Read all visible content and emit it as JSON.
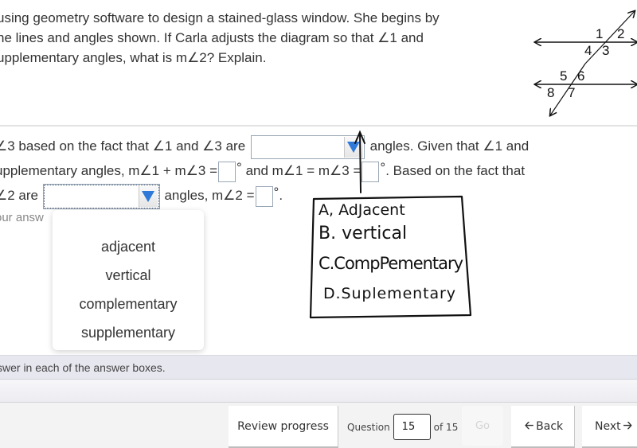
{
  "question": {
    "lines": [
      "using geometry software to design a stained-glass window. She begins by",
      "he lines and angles shown. If Carla adjusts the diagram so that ∠1 and",
      "upplementary angles, what is m∠2? Explain."
    ]
  },
  "diagram": {
    "labels": [
      "1",
      "2",
      "3",
      "4",
      "5",
      "6",
      "7",
      "8"
    ]
  },
  "answer": {
    "line1_a": "∠3 based on the fact that ∠1 and ∠3 are",
    "line1_b": "angles. Given that ∠1 and",
    "line2_a": "upplementary angles, m∠1 + m∠3 =",
    "line2_b": "and m∠1 = m∠3 =",
    "line2_c": ". Based on the fact that",
    "line3_a": "∠2 are",
    "line3_b": "angles, m∠2 =",
    "line3_c": ".",
    "degree": "°",
    "dropdown1_value": "",
    "dropdown2_value": "",
    "box1_value": "",
    "box2_value": "",
    "box3_value": ""
  },
  "hint": "our answ",
  "dropdown_menu": {
    "options": [
      "adjacent",
      "vertical",
      "complementary",
      "supplementary"
    ]
  },
  "sketch": {
    "lines": [
      "A, AdJacent",
      "B. vertical",
      "C.CompPementary",
      "D.Suplementary"
    ]
  },
  "instructions": "swer in each of the answer boxes.",
  "footer": {
    "review_label": "Review progress",
    "question_label": "Question",
    "question_value": "15",
    "of_label": "of 15",
    "go_label": "Go",
    "back_label": "Back",
    "next_label": "Next"
  }
}
